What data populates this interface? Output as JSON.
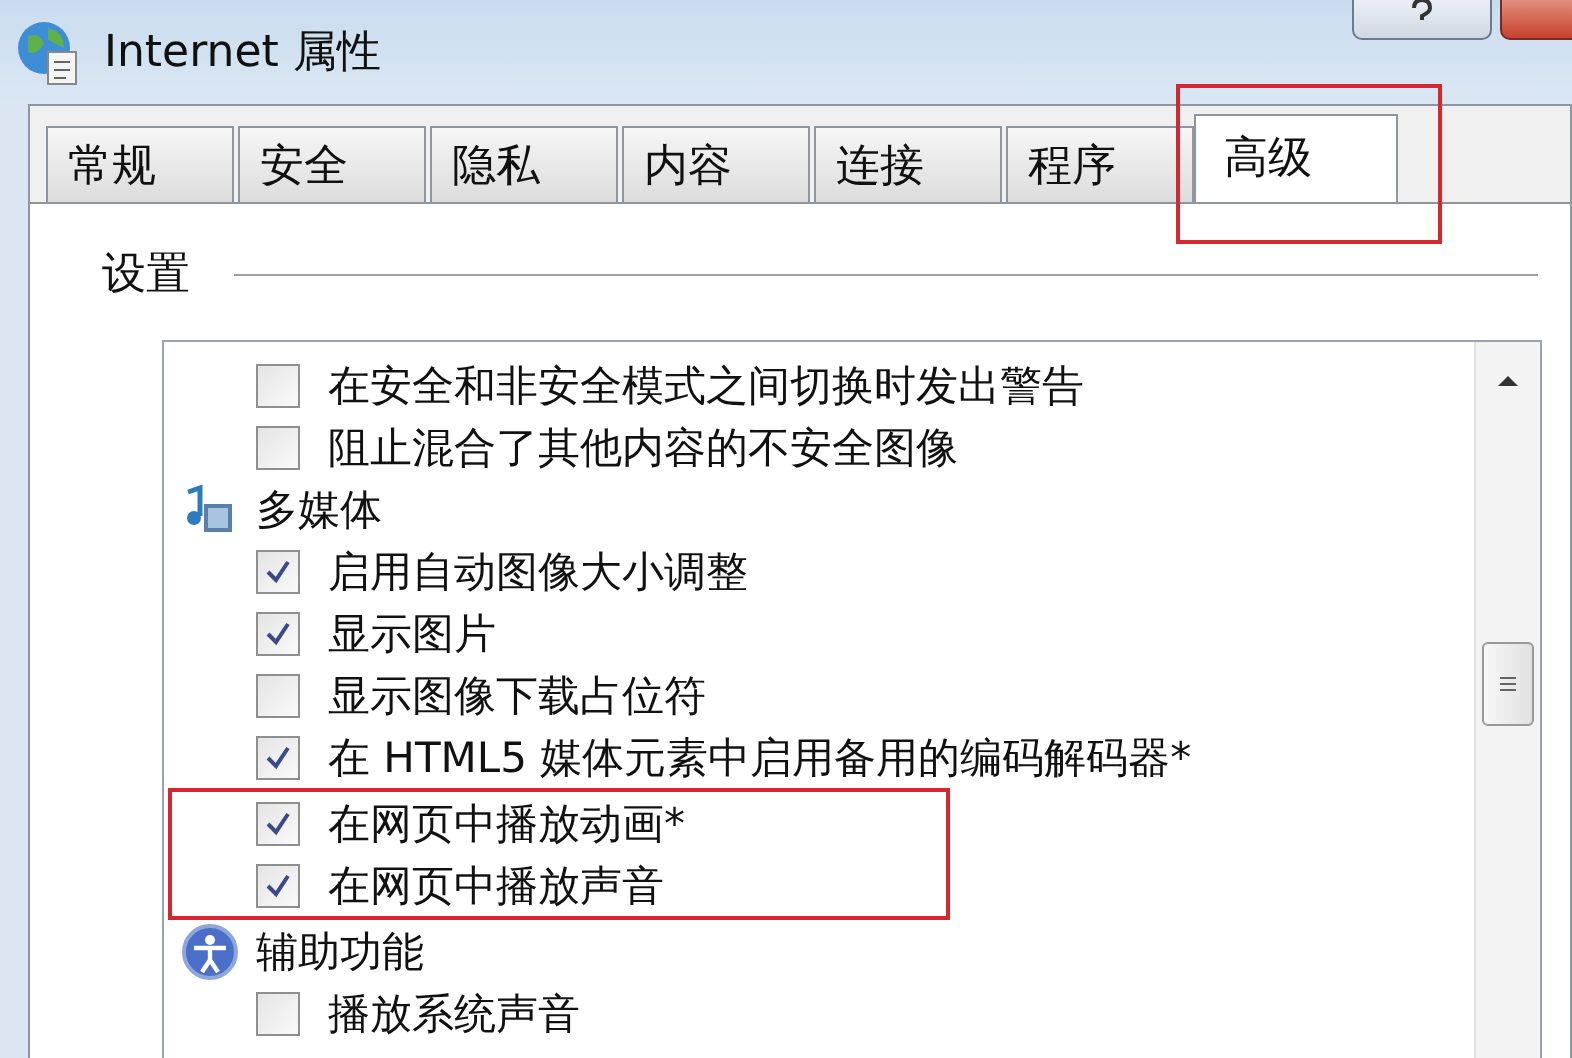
{
  "window": {
    "title": "Internet 属性"
  },
  "tabs": [
    {
      "label": "常规",
      "selected": false,
      "highlighted": false
    },
    {
      "label": "安全",
      "selected": false,
      "highlighted": false
    },
    {
      "label": "隐私",
      "selected": false,
      "highlighted": false
    },
    {
      "label": "内容",
      "selected": false,
      "highlighted": false
    },
    {
      "label": "连接",
      "selected": false,
      "highlighted": false
    },
    {
      "label": "程序",
      "selected": false,
      "highlighted": false
    },
    {
      "label": "高级",
      "selected": true,
      "highlighted": true
    }
  ],
  "settings": {
    "label": "设置",
    "items": [
      {
        "kind": "checkbox",
        "label": "在安全和非安全模式之间切换时发出警告",
        "checked": false,
        "highlighted": false
      },
      {
        "kind": "checkbox",
        "label": "阻止混合了其他内容的不安全图像",
        "checked": false,
        "highlighted": false
      },
      {
        "kind": "group",
        "label": "多媒体"
      },
      {
        "kind": "checkbox",
        "label": "启用自动图像大小调整",
        "checked": true,
        "highlighted": false
      },
      {
        "kind": "checkbox",
        "label": "显示图片",
        "checked": true,
        "highlighted": false
      },
      {
        "kind": "checkbox",
        "label": "显示图像下载占位符",
        "checked": false,
        "highlighted": false
      },
      {
        "kind": "checkbox",
        "label": "在 HTML5 媒体元素中启用备用的编码解码器*",
        "checked": true,
        "highlighted": false
      },
      {
        "kind": "checkbox",
        "label": "在网页中播放动画*",
        "checked": true,
        "highlighted": true
      },
      {
        "kind": "checkbox",
        "label": "在网页中播放声音",
        "checked": true,
        "highlighted": true
      },
      {
        "kind": "group",
        "label": "辅助功能"
      },
      {
        "kind": "checkbox",
        "label": "播放系统声音",
        "checked": false,
        "highlighted": false
      }
    ]
  }
}
